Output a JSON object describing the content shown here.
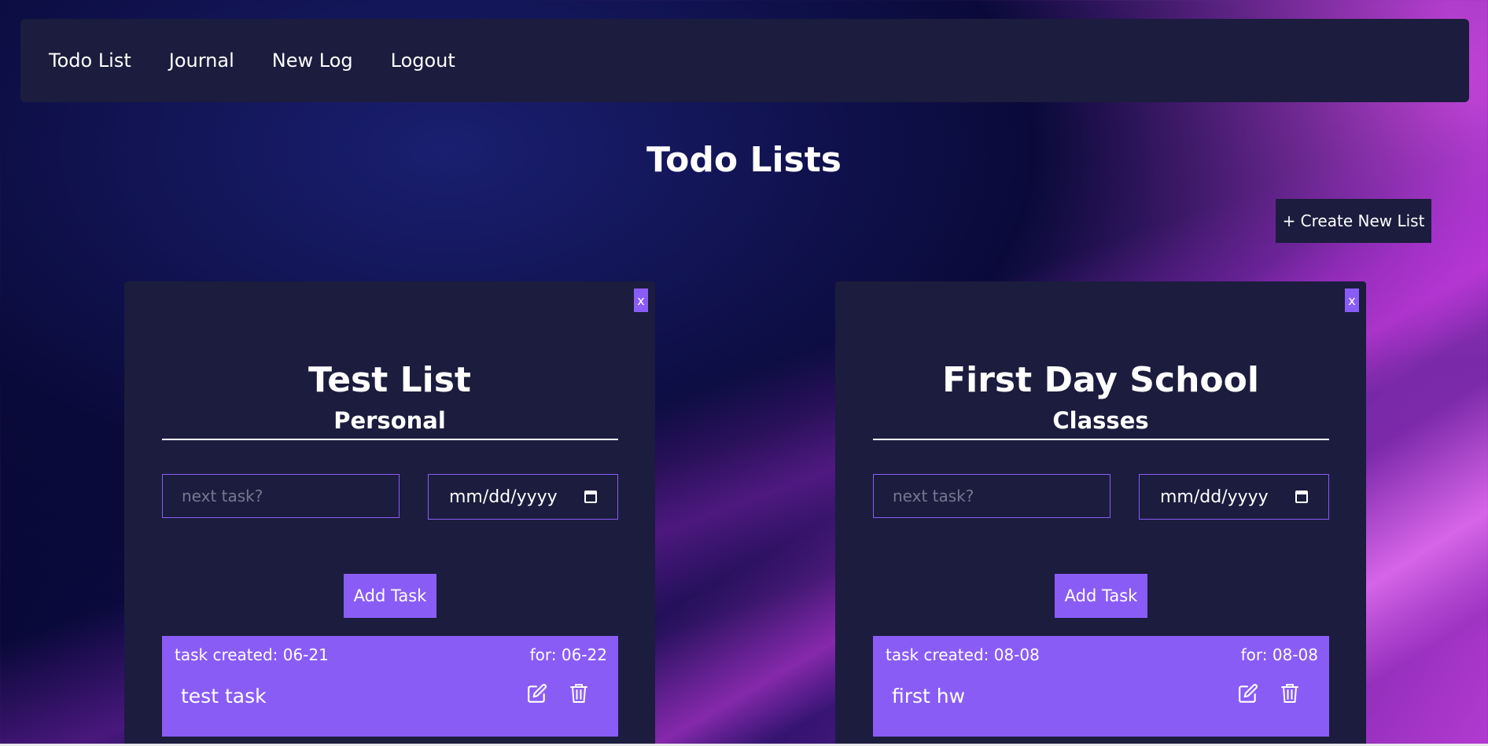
{
  "nav": {
    "items": [
      {
        "label": "Todo List"
      },
      {
        "label": "Journal"
      },
      {
        "label": "New Log"
      },
      {
        "label": "Logout"
      }
    ]
  },
  "page": {
    "title": "Todo Lists",
    "create_button": "+ Create New List"
  },
  "lists": [
    {
      "close_label": "x",
      "title": "Test List",
      "category": "Personal",
      "task_placeholder": "next task?",
      "date_placeholder": "mm/dd/yyyy",
      "add_label": "Add Task",
      "tasks": [
        {
          "created": "task created: 06-21",
          "due": "for: 06-22",
          "text": "test task"
        }
      ]
    },
    {
      "close_label": "x",
      "title": "First Day School",
      "category": "Classes",
      "task_placeholder": "next task?",
      "date_placeholder": "mm/dd/yyyy",
      "add_label": "Add Task",
      "tasks": [
        {
          "created": "task created: 08-08",
          "due": "for: 08-08",
          "text": "first hw"
        }
      ]
    }
  ],
  "colors": {
    "panel": "#1c1c3e",
    "accent": "#8a5cf6",
    "text": "#ffffff"
  },
  "icons": {
    "edit": "edit-icon",
    "delete": "trash-icon",
    "calendar": "calendar-icon"
  }
}
